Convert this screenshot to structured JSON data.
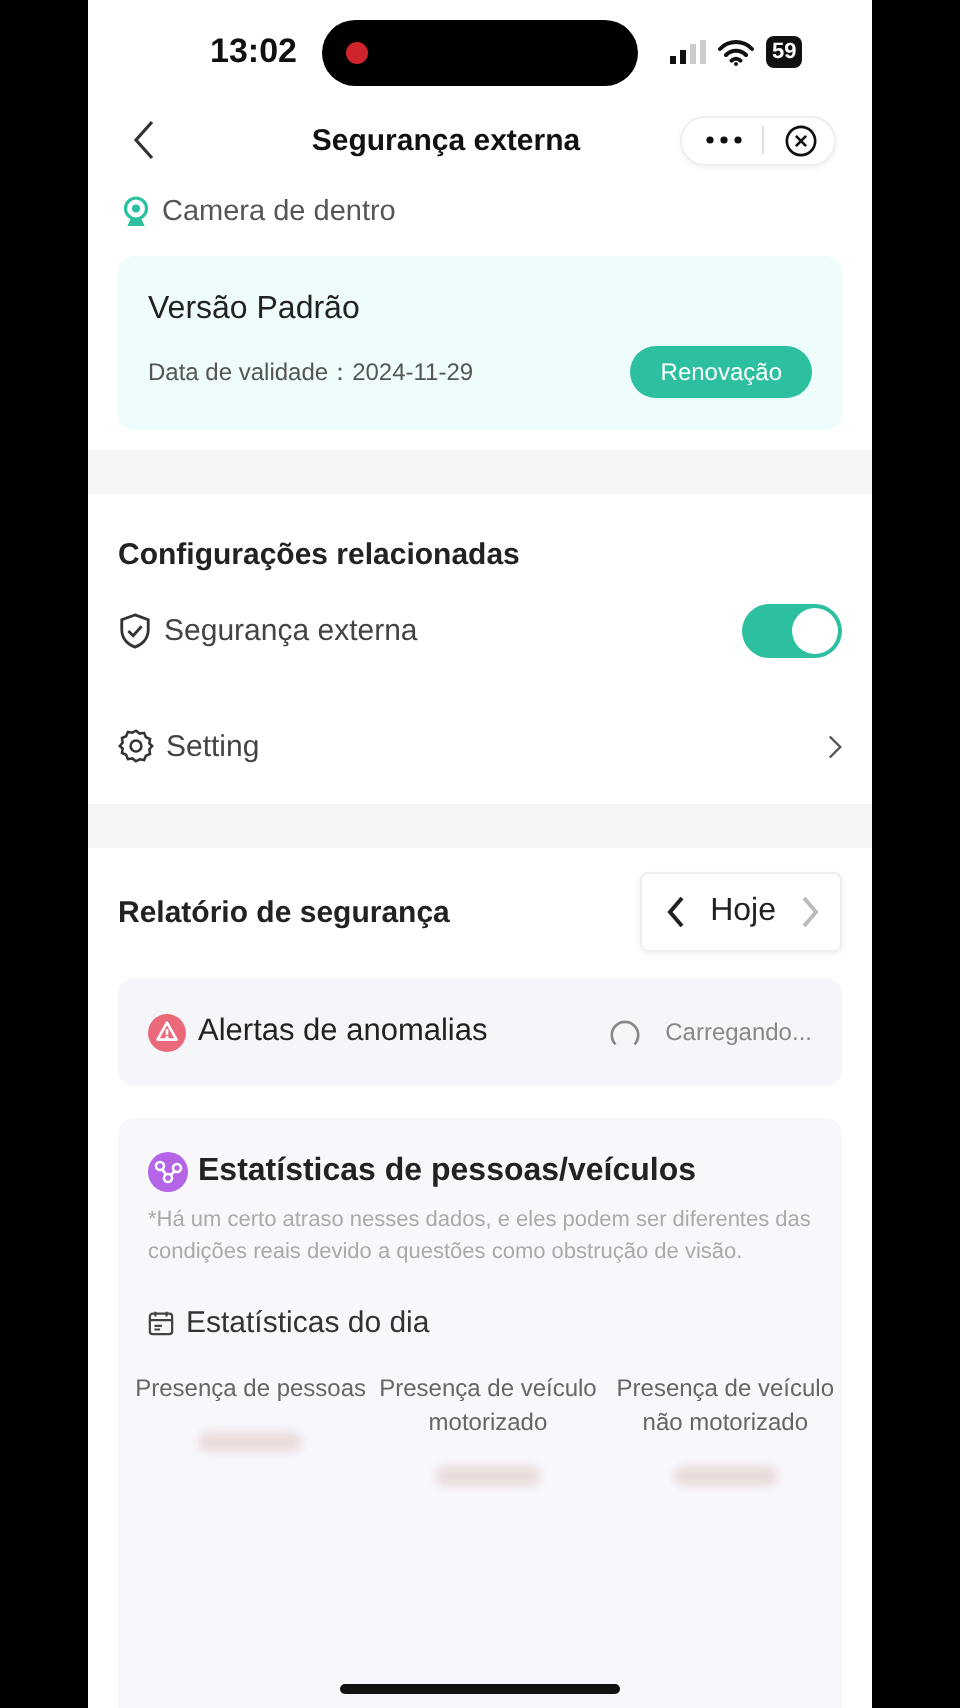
{
  "status_bar": {
    "time": "13:02",
    "battery": "59"
  },
  "nav": {
    "title": "Segurança externa"
  },
  "device": {
    "name": "Camera de dentro"
  },
  "plan": {
    "title": "Versão Padrão",
    "validity": "Data de validade：2024-11-29",
    "button": "Renovação"
  },
  "settings": {
    "title": "Configurações relacionadas",
    "items": [
      {
        "kind": "toggle",
        "label": "Segurança externa",
        "on": true
      },
      {
        "kind": "link",
        "label": "Setting"
      }
    ]
  },
  "report": {
    "title": "Relatório de segurança",
    "date": "Hoje",
    "next_disabled": true
  },
  "alerts": {
    "title": "Alertas de anomalias",
    "status": "Carregando..."
  },
  "stats": {
    "title": "Estatísticas de pessoas/veículos",
    "note": "*Há um certo atraso nesses dados, e eles podem ser diferentes das condições reais devido a questões como obstrução de visão.",
    "day_title": "Estatísticas do dia",
    "columns": [
      {
        "label": "Presença de pessoas"
      },
      {
        "label": "Presença de veículo motorizado"
      },
      {
        "label": "Presença de veículo não motorizado"
      }
    ]
  }
}
